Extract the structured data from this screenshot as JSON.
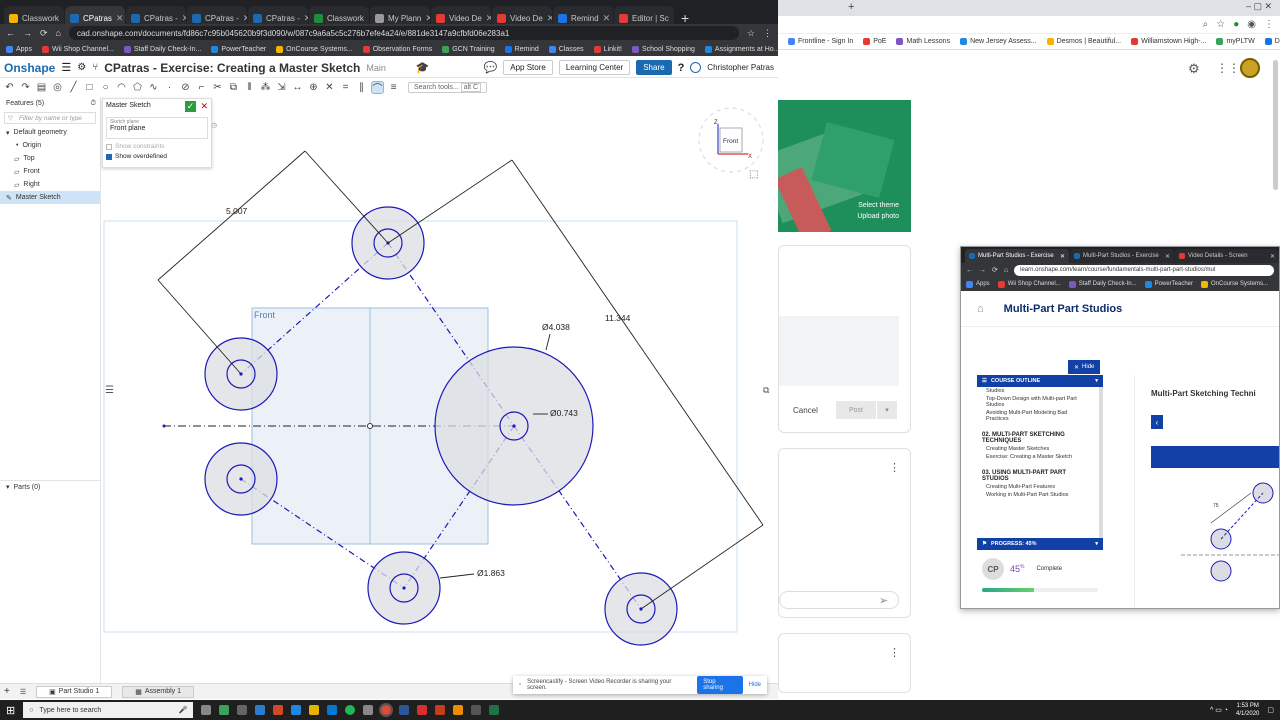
{
  "left_browser": {
    "tabs": [
      {
        "label": "Classwork",
        "color": "#f4b400"
      },
      {
        "label": "CPatras",
        "color": "#1b6ab1",
        "active": true
      },
      {
        "label": "CPatras -",
        "color": "#1b6ab1"
      },
      {
        "label": "CPatras -",
        "color": "#1b6ab1"
      },
      {
        "label": "CPatras -",
        "color": "#1b6ab1"
      },
      {
        "label": "Classwork",
        "color": "#1e8e3e"
      },
      {
        "label": "My Plann",
        "color": "#999999"
      },
      {
        "label": "Video De",
        "color": "#e53935"
      },
      {
        "label": "Video De",
        "color": "#e53935"
      },
      {
        "label": "Remind",
        "color": "#1a73e8"
      },
      {
        "label": "Editor | Sc",
        "color": "#e53935"
      }
    ],
    "url": "cad.onshape.com/documents/fd86c7c95b045620b9f3d090/w/087c9a6a5c5c276b7efe4a24/e/881de3147a9cfbfd06e283a1",
    "bookmarks": [
      "Apps",
      "Wii Shop Channel...",
      "Staff Daily Check-In...",
      "PowerTeacher",
      "OnCourse Systems...",
      "Observation Forms",
      "GCN Training",
      "Remind",
      "Classes",
      "Linkit!",
      "School Shopping",
      "Assignments at Ho..."
    ]
  },
  "onshape": {
    "logo": "Onshape",
    "title": "CPatras - Exercise: Creating a Master Sketch",
    "workspace": "Main",
    "app_store": "App Store",
    "learning_center": "Learning Center",
    "share": "Share",
    "help": "?",
    "user": "Christopher Patras",
    "search_tools": "Search tools...",
    "search_shortcut": "alt C",
    "features_header": "Features (5)",
    "filter_placeholder": "Filter by name or type",
    "tree": [
      "Default geometry",
      "Origin",
      "Top",
      "Front",
      "Right",
      "Master Sketch"
    ],
    "parts": "Parts (0)",
    "sketch_dialog": {
      "title": "Master Sketch",
      "plane_label": "Sketch plane",
      "plane": "Front plane",
      "show_constraints": "Show constraints",
      "show_overdefined": "Show overdefined"
    },
    "viewcube_label": "Front",
    "plane_label": "Front",
    "dimensions": {
      "d1": "5.007",
      "d2": "11.344",
      "d3": "Ø4.038",
      "d4": "Ø0.743",
      "d5": "Ø1.863"
    },
    "bottom_tabs": [
      "Part Studio 1",
      "Assembly 1"
    ],
    "screencastify_text": "Screencastify - Screen Video Recorder is sharing your screen.",
    "stop_sharing": "Stop sharing",
    "hide": "Hide"
  },
  "right_browser": {
    "bookmarks": [
      "Frontline - Sign In",
      "PoE",
      "Math Lessons",
      "New Jersey Assess...",
      "Desmos | Beautiful...",
      "Williamstown High-...",
      "myPLTW",
      "Discord"
    ],
    "select_theme": "Select theme",
    "upload_photo": "Upload photo",
    "cancel": "Cancel",
    "post": "Post"
  },
  "learn_window": {
    "tabs": [
      "Multi-Part Studios - Exercise",
      "Multi-Part Studios - Exercise",
      "Video Details - Screen"
    ],
    "url": "learn.onshape.com/learn/course/fundamentals-multi-part-part-studios/mul",
    "bookmarks": [
      "Apps",
      "Wii Shop Channel...",
      "Staff Daily Check-In...",
      "PowerTeacher",
      "OnCourse Systems..."
    ],
    "course_title": "Multi-Part Part Studios",
    "hide": "Hide",
    "course_outline": "COURSE OUTLINE",
    "outline_items": [
      {
        "type": "item",
        "text": "Studios"
      },
      {
        "type": "item",
        "text": "Top-Down Design with Multi-part Part Studios"
      },
      {
        "type": "item",
        "text": "Avoiding Multi-Part Modeling Bad Practices"
      },
      {
        "type": "section",
        "text": "02. MULTI-PART SKETCHING TECHNIQUES"
      },
      {
        "type": "item",
        "text": "Creating Master Sketches"
      },
      {
        "type": "item",
        "text": "Exercise: Creating a Master Sketch"
      },
      {
        "type": "section",
        "text": "03. USING MULTI-PART PART STUDIOS"
      },
      {
        "type": "item",
        "text": "Creating Multi-Part Features"
      },
      {
        "type": "item",
        "text": "Working in Multi-Part Part Studios"
      }
    ],
    "progress_label": "PROGRESS: 45%",
    "progress": 0.45,
    "avatar": "CP",
    "percent": "45",
    "percent_unit": "%",
    "complete": "Complete",
    "lesson_title": "Multi-Part Sketching Techni",
    "thumb_dim": "75"
  },
  "taskbar": {
    "search": "Type here to search",
    "time": "1:53 PM",
    "date": "4/1/2020"
  },
  "colors": {
    "onshape_blue": "#1b6ab1",
    "sketch_blue": "#1a1ab8",
    "learn_blue": "#1140a6",
    "classroom_green": "#1e8e5a"
  }
}
